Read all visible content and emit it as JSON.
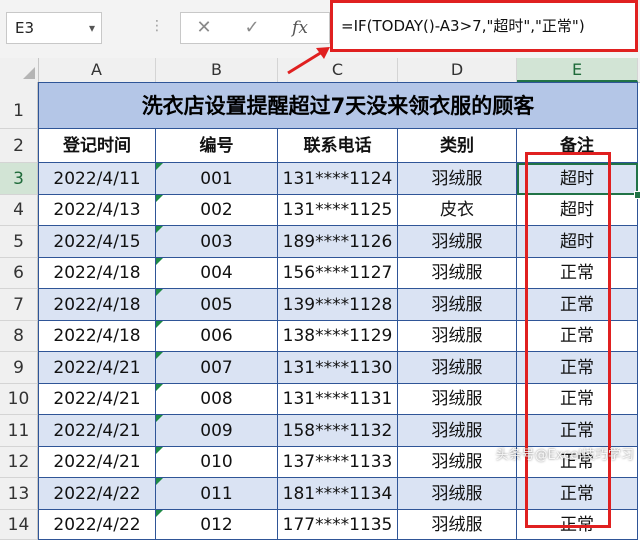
{
  "formula_bar": {
    "name_box": "E3",
    "cancel_symbol": "✕",
    "enter_symbol": "✓",
    "fx_symbol": "fx",
    "formula": "=IF(TODAY()-A3>7,\"超时\",\"正常\")"
  },
  "columns": [
    "A",
    "B",
    "C",
    "D",
    "E"
  ],
  "selected_column": "E",
  "selected_row": "3",
  "row_numbers": [
    "1",
    "2",
    "3",
    "4",
    "5",
    "6",
    "7",
    "8",
    "9",
    "10",
    "11",
    "12",
    "13",
    "14"
  ],
  "title": "洗衣店设置提醒超过7天没来领衣服的顾客",
  "headers": [
    "登记时间",
    "编号",
    "联系电话",
    "类别",
    "备注"
  ],
  "rows": [
    [
      "2022/4/11",
      "001",
      "131****1124",
      "羽绒服",
      "超时"
    ],
    [
      "2022/4/13",
      "002",
      "131****1125",
      "皮衣",
      "超时"
    ],
    [
      "2022/4/15",
      "003",
      "189****1126",
      "羽绒服",
      "超时"
    ],
    [
      "2022/4/18",
      "004",
      "156****1127",
      "羽绒服",
      "正常"
    ],
    [
      "2022/4/18",
      "005",
      "139****1128",
      "羽绒服",
      "正常"
    ],
    [
      "2022/4/18",
      "006",
      "138****1129",
      "羽绒服",
      "正常"
    ],
    [
      "2022/4/21",
      "007",
      "131****1130",
      "羽绒服",
      "正常"
    ],
    [
      "2022/4/21",
      "008",
      "131****1131",
      "羽绒服",
      "正常"
    ],
    [
      "2022/4/21",
      "009",
      "158****1132",
      "羽绒服",
      "正常"
    ],
    [
      "2022/4/21",
      "010",
      "137****1133",
      "羽绒服",
      "正常"
    ],
    [
      "2022/4/22",
      "011",
      "181****1134",
      "羽绒服",
      "正常"
    ],
    [
      "2022/4/22",
      "012",
      "177****1135",
      "羽绒服",
      "正常"
    ]
  ],
  "watermark": "头条号@Excel技巧学习",
  "colors": {
    "title_fill": "#b4c6e7",
    "band_fill": "#dae3f3",
    "border": "#2f5597",
    "highlight": "#e02020",
    "excel_green": "#217346"
  }
}
